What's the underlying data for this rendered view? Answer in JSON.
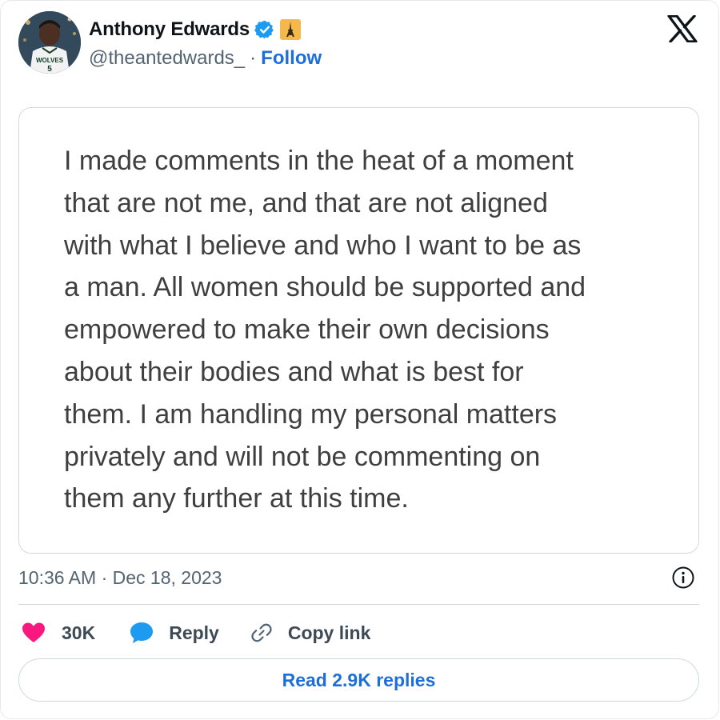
{
  "author": {
    "name": "Anthony Edwards",
    "handle": "@theantedwards_",
    "separator": "·",
    "follow_label": "Follow",
    "verified_color": "#1d9bf0",
    "avatar_icon": "player-photo",
    "avatar_jersey_text": "WOLVES",
    "avatar_jersey_number": "5",
    "badge_icon": "tokyo-tower-emoji"
  },
  "brand": {
    "logo_icon": "x-logo"
  },
  "statement": {
    "lines": [
      "I made comments in the heat of a moment",
      "that are not me, and that are not aligned",
      "with what I believe and who I want to be as",
      "a man. All women should be supported and",
      "empowered to make their own decisions",
      "about their bodies and what is best for",
      "them. I am handling my personal matters",
      "privately and will not be commenting on",
      "them any further at this time."
    ]
  },
  "meta": {
    "timestamp": "10:36 AM · Dec 18, 2023",
    "info_icon": "info-icon"
  },
  "actions": {
    "like_count": "30K",
    "like_color": "#f91880",
    "reply_label": "Reply",
    "reply_color": "#1d9bf0",
    "copy_label": "Copy link"
  },
  "footer": {
    "read_replies_label": "Read 2.9K replies"
  },
  "colors": {
    "accent": "#1d6fd8",
    "muted": "#536471"
  }
}
